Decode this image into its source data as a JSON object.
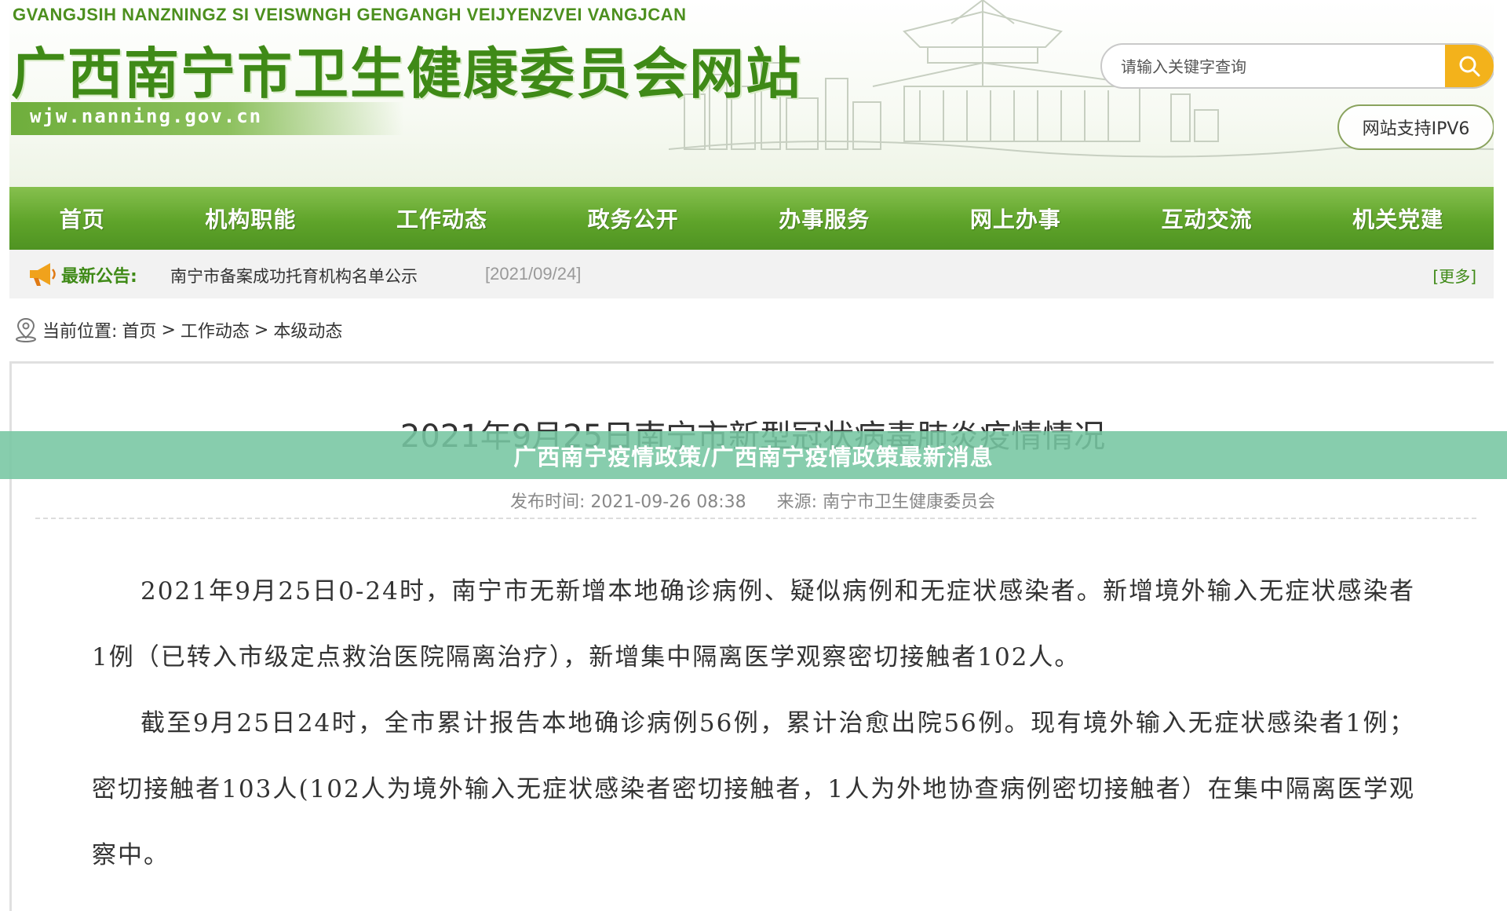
{
  "header": {
    "pinyin": "GVANGJSIH NANZNINGZ SI VEISWNGH GENGANGH VEIJYENZVEI VANGJCAN",
    "title": "广西南宁市卫生健康委员会网站",
    "domain": "wjw.nanning.gov.cn",
    "search_placeholder": "请输入关键字查询",
    "ipv6_label": "网站支持IPV6"
  },
  "nav": {
    "items": [
      "首页",
      "机构职能",
      "工作动态",
      "政务公开",
      "办事服务",
      "网上办事",
      "互动交流",
      "机关党建"
    ]
  },
  "notice": {
    "label": "最新公告:",
    "link_text": "南宁市备案成功托育机构名单公示",
    "date": "[2021/09/24]",
    "more": "[更多]"
  },
  "breadcrumb": {
    "label": "当前位置:",
    "items": [
      "首页",
      "工作动态",
      "本级动态"
    ],
    "separator": ">"
  },
  "article": {
    "title": "2021年9月25日南宁市新型冠状病毒肺炎疫情情况",
    "publish_time": "发布时间: 2021-09-26 08:38",
    "source": "来源: 南宁市卫生健康委员会",
    "paragraphs": [
      "2021年9月25日0-24时，南宁市无新增本地确诊病例、疑似病例和无症状感染者。新增境外输入无症状感染者1例（已转入市级定点救治医院隔离治疗），新增集中隔离医学观察密切接触者102人。",
      "截至9月25日24时，全市累计报告本地确诊病例56例，累计治愈出院56例。现有境外输入无症状感染者1例；密切接触者103人(102人为境外输入无症状感染者密切接触者，1人为外地协查病例密切接触者）在集中隔离医学观察中。"
    ]
  },
  "overlay": {
    "text": "广西南宁疫情政策/广西南宁疫情政策最新消息"
  },
  "colors": {
    "brand_green": "#3f8a17",
    "nav_green": "#5fa42a",
    "search_button": "#f3b21b",
    "overlay": "#76c6a2"
  }
}
